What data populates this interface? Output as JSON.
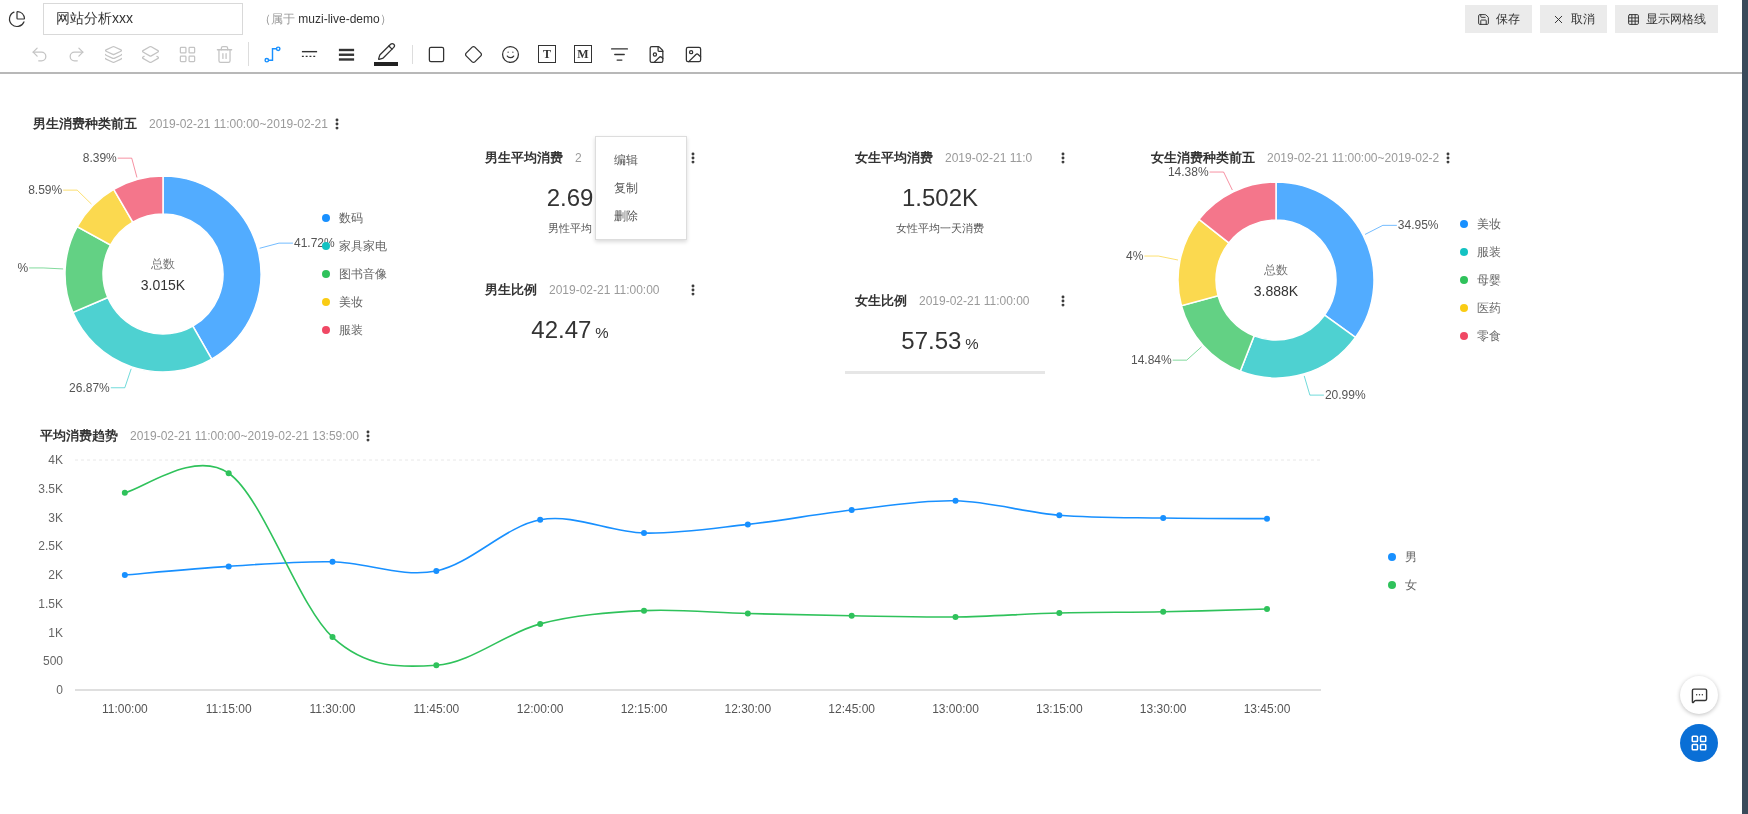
{
  "header": {
    "title_value": "网站分析xxx",
    "owner_prefix": "（属于",
    "owner": "muzi-live-demo",
    "owner_suffix": "）",
    "buttons": [
      {
        "kind": "save",
        "label": "保存"
      },
      {
        "kind": "cancel",
        "label": "取消"
      },
      {
        "kind": "grid",
        "label": "显示网格线"
      }
    ]
  },
  "toolbar": {
    "groups": [
      [
        {
          "kind": "undo",
          "disabled": true,
          "selected": false
        },
        {
          "kind": "redo",
          "disabled": true,
          "selected": false
        },
        {
          "kind": "bring-forward",
          "disabled": true,
          "selected": false
        },
        {
          "kind": "send-backward",
          "disabled": true,
          "selected": false
        },
        {
          "kind": "grid-layout",
          "disabled": true,
          "selected": false
        },
        {
          "kind": "delete",
          "disabled": true,
          "selected": false
        }
      ],
      [
        {
          "kind": "connector",
          "disabled": false,
          "selected": true
        },
        {
          "kind": "dashed-line",
          "disabled": false,
          "selected": false
        },
        {
          "kind": "line-weight",
          "disabled": false,
          "selected": false
        },
        {
          "kind": "pencil",
          "disabled": false,
          "selected": false
        }
      ],
      [
        {
          "kind": "rectangle",
          "disabled": false,
          "selected": false
        },
        {
          "kind": "diamond",
          "disabled": false,
          "selected": false
        },
        {
          "kind": "emoji",
          "disabled": false,
          "selected": false
        },
        {
          "kind": "glyph-box",
          "glyph": "T",
          "disabled": false,
          "selected": false
        },
        {
          "kind": "glyph-box",
          "glyph": "M",
          "disabled": false,
          "selected": false
        },
        {
          "kind": "filter",
          "disabled": false,
          "selected": false
        },
        {
          "kind": "file",
          "disabled": false,
          "selected": false
        },
        {
          "kind": "image",
          "disabled": false,
          "selected": false
        }
      ]
    ]
  },
  "donuts": [
    {
      "title": "男生消费种类前五",
      "date_range": "2019-02-21 11:00:00~2019-02-21",
      "center_label": "总数",
      "center_value": "3.015K",
      "slice_labels": [
        "41.72%",
        "26.87%",
        "%",
        "8.59%",
        "8.39%"
      ],
      "legend": [
        {
          "color": "#1890ff"
        },
        {
          "color": "#13c2c2"
        },
        {
          "color": "#2fc25b"
        },
        {
          "color": "#facc14"
        },
        {
          "color": "#f04864"
        }
      ],
      "chart_data": {
        "type": "donut",
        "categories": [
          "数码",
          "家具家电",
          "图书音像",
          "美妆",
          "服装"
        ],
        "values": [
          41.72,
          26.87,
          14.43,
          8.59,
          8.39
        ]
      }
    },
    {
      "title": "女生消费种类前五",
      "date_range": "2019-02-21 11:00:00~2019-02-2",
      "center_label": "总数",
      "center_value": "3.888K",
      "slice_labels": [
        "34.95%",
        "20.99%",
        "14.84%",
        "4%",
        "14.38%"
      ],
      "legend": [
        {
          "color": "#1890ff"
        },
        {
          "color": "#13c2c2"
        },
        {
          "color": "#2fc25b"
        },
        {
          "color": "#facc14"
        },
        {
          "color": "#f04864"
        }
      ],
      "chart_data": {
        "type": "donut",
        "categories": [
          "美妆",
          "服装",
          "母婴",
          "医药",
          "零食"
        ],
        "values": [
          34.95,
          20.99,
          14.84,
          14.84,
          14.38
        ]
      }
    }
  ],
  "stats": [
    {
      "title": "男生平均消费",
      "date_range": "2",
      "value": "2.69",
      "caption": "男性平均"
    },
    {
      "title": "男生比例",
      "date_range": "2019-02-21 11:00:00",
      "value": "42.47",
      "unit": "%"
    },
    {
      "title": "女生平均消费",
      "date_range": "2019-02-21 11:0",
      "value": "1.502K",
      "caption": "女性平均一天消费"
    },
    {
      "title": "女生比例",
      "date_range": "2019-02-21 11:00:00",
      "value": "57.53",
      "unit": "%"
    }
  ],
  "context_menu": {
    "items": [
      "编辑",
      "复制",
      "删除"
    ]
  },
  "trend": {
    "title": "平均消费趋势",
    "date_range": "2019-02-21 11:00:00~2019-02-21 13:59:00",
    "chart_data": {
      "type": "line",
      "categories": [
        "11:00:00",
        "11:15:00",
        "11:30:00",
        "11:45:00",
        "12:00:00",
        "12:15:00",
        "12:30:00",
        "12:45:00",
        "13:00:00",
        "13:15:00",
        "13:30:00",
        "13:45:00"
      ],
      "series": [
        {
          "name": "男",
          "color": "#1890ff",
          "marker": true,
          "values": [
            2000,
            2150,
            2230,
            2070,
            2960,
            2730,
            2880,
            3130,
            3290,
            3040,
            2990,
            2980
          ]
        },
        {
          "name": "女",
          "color": "#2fc25b",
          "marker": true,
          "values": [
            3430,
            3770,
            920,
            430,
            1150,
            1380,
            1330,
            1290,
            1270,
            1340,
            1360,
            1410
          ]
        }
      ],
      "ylim": [
        0,
        4000
      ],
      "yticks": [
        {
          "value": 0,
          "label": "0"
        },
        {
          "value": 500,
          "label": "500"
        },
        {
          "value": 1000,
          "label": "1K"
        },
        {
          "value": 1500,
          "label": "1.5K"
        },
        {
          "value": 2000,
          "label": "2K"
        },
        {
          "value": 2500,
          "label": "2.5K"
        },
        {
          "value": 3000,
          "label": "3K"
        },
        {
          "value": 3500,
          "label": "3.5K"
        },
        {
          "value": 4000,
          "label": "4K"
        }
      ]
    }
  }
}
